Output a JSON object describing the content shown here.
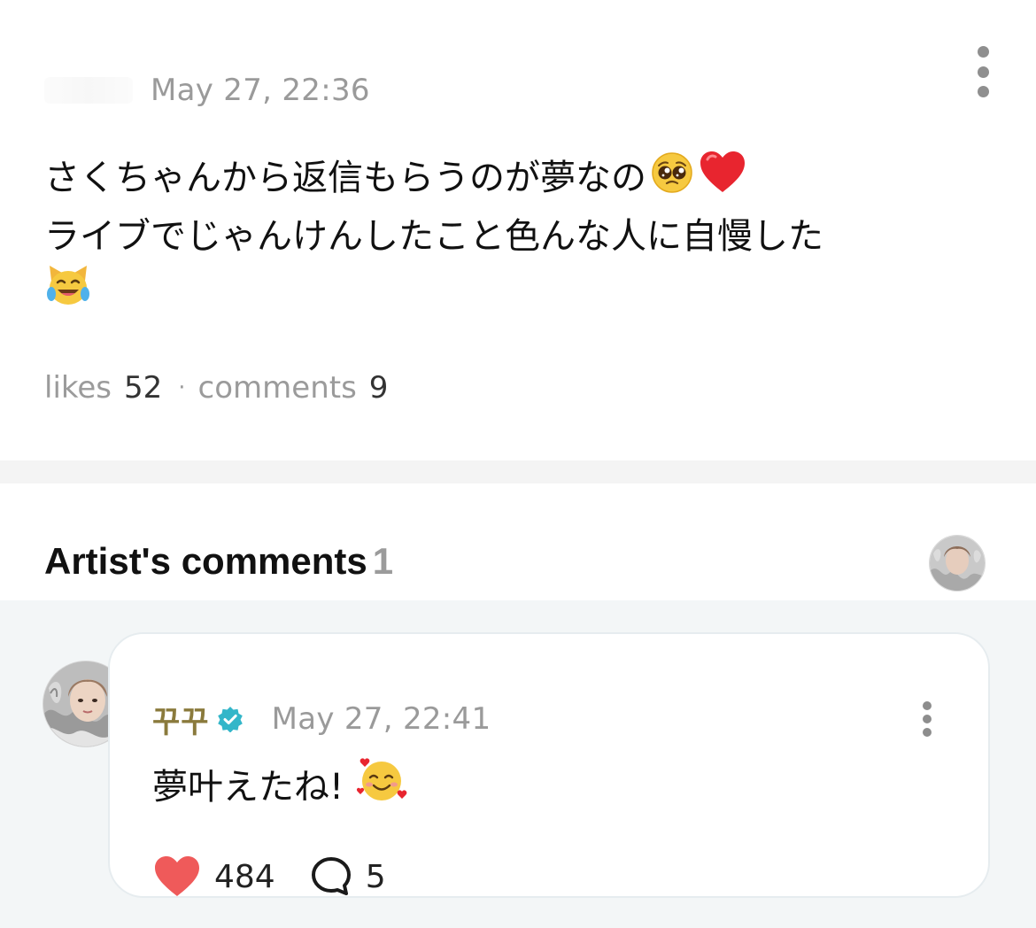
{
  "post": {
    "date": "May 27, 22:36",
    "body_lines": [
      "さくちゃんから返信もらうのが夢なの",
      "ライブでじゃんけんしたこと色んな人に自慢した"
    ],
    "emojis": [
      "pleading-face",
      "red-heart",
      "cat-tears-of-joy"
    ],
    "stats": {
      "likes_label": "likes",
      "likes_count": "52",
      "separator": "·",
      "comments_label": "comments",
      "comments_count": "9"
    }
  },
  "artist_comments": {
    "title": "Artist's comments",
    "count": "1",
    "comment": {
      "author": "꾸꾸",
      "verified": true,
      "date": "May 27, 22:41",
      "text": "夢叶えたね!",
      "emoji": "smiling-face-with-hearts",
      "likes": "484",
      "replies": "5"
    }
  },
  "colors": {
    "muted_text": "#9a9a9a",
    "author_name": "#8a7a3c",
    "verified_badge": "#33b6c9",
    "like_heart": "#ef5a5a",
    "comment_area_bg": "#f3f6f7",
    "divider_band": "#f4f4f4"
  }
}
